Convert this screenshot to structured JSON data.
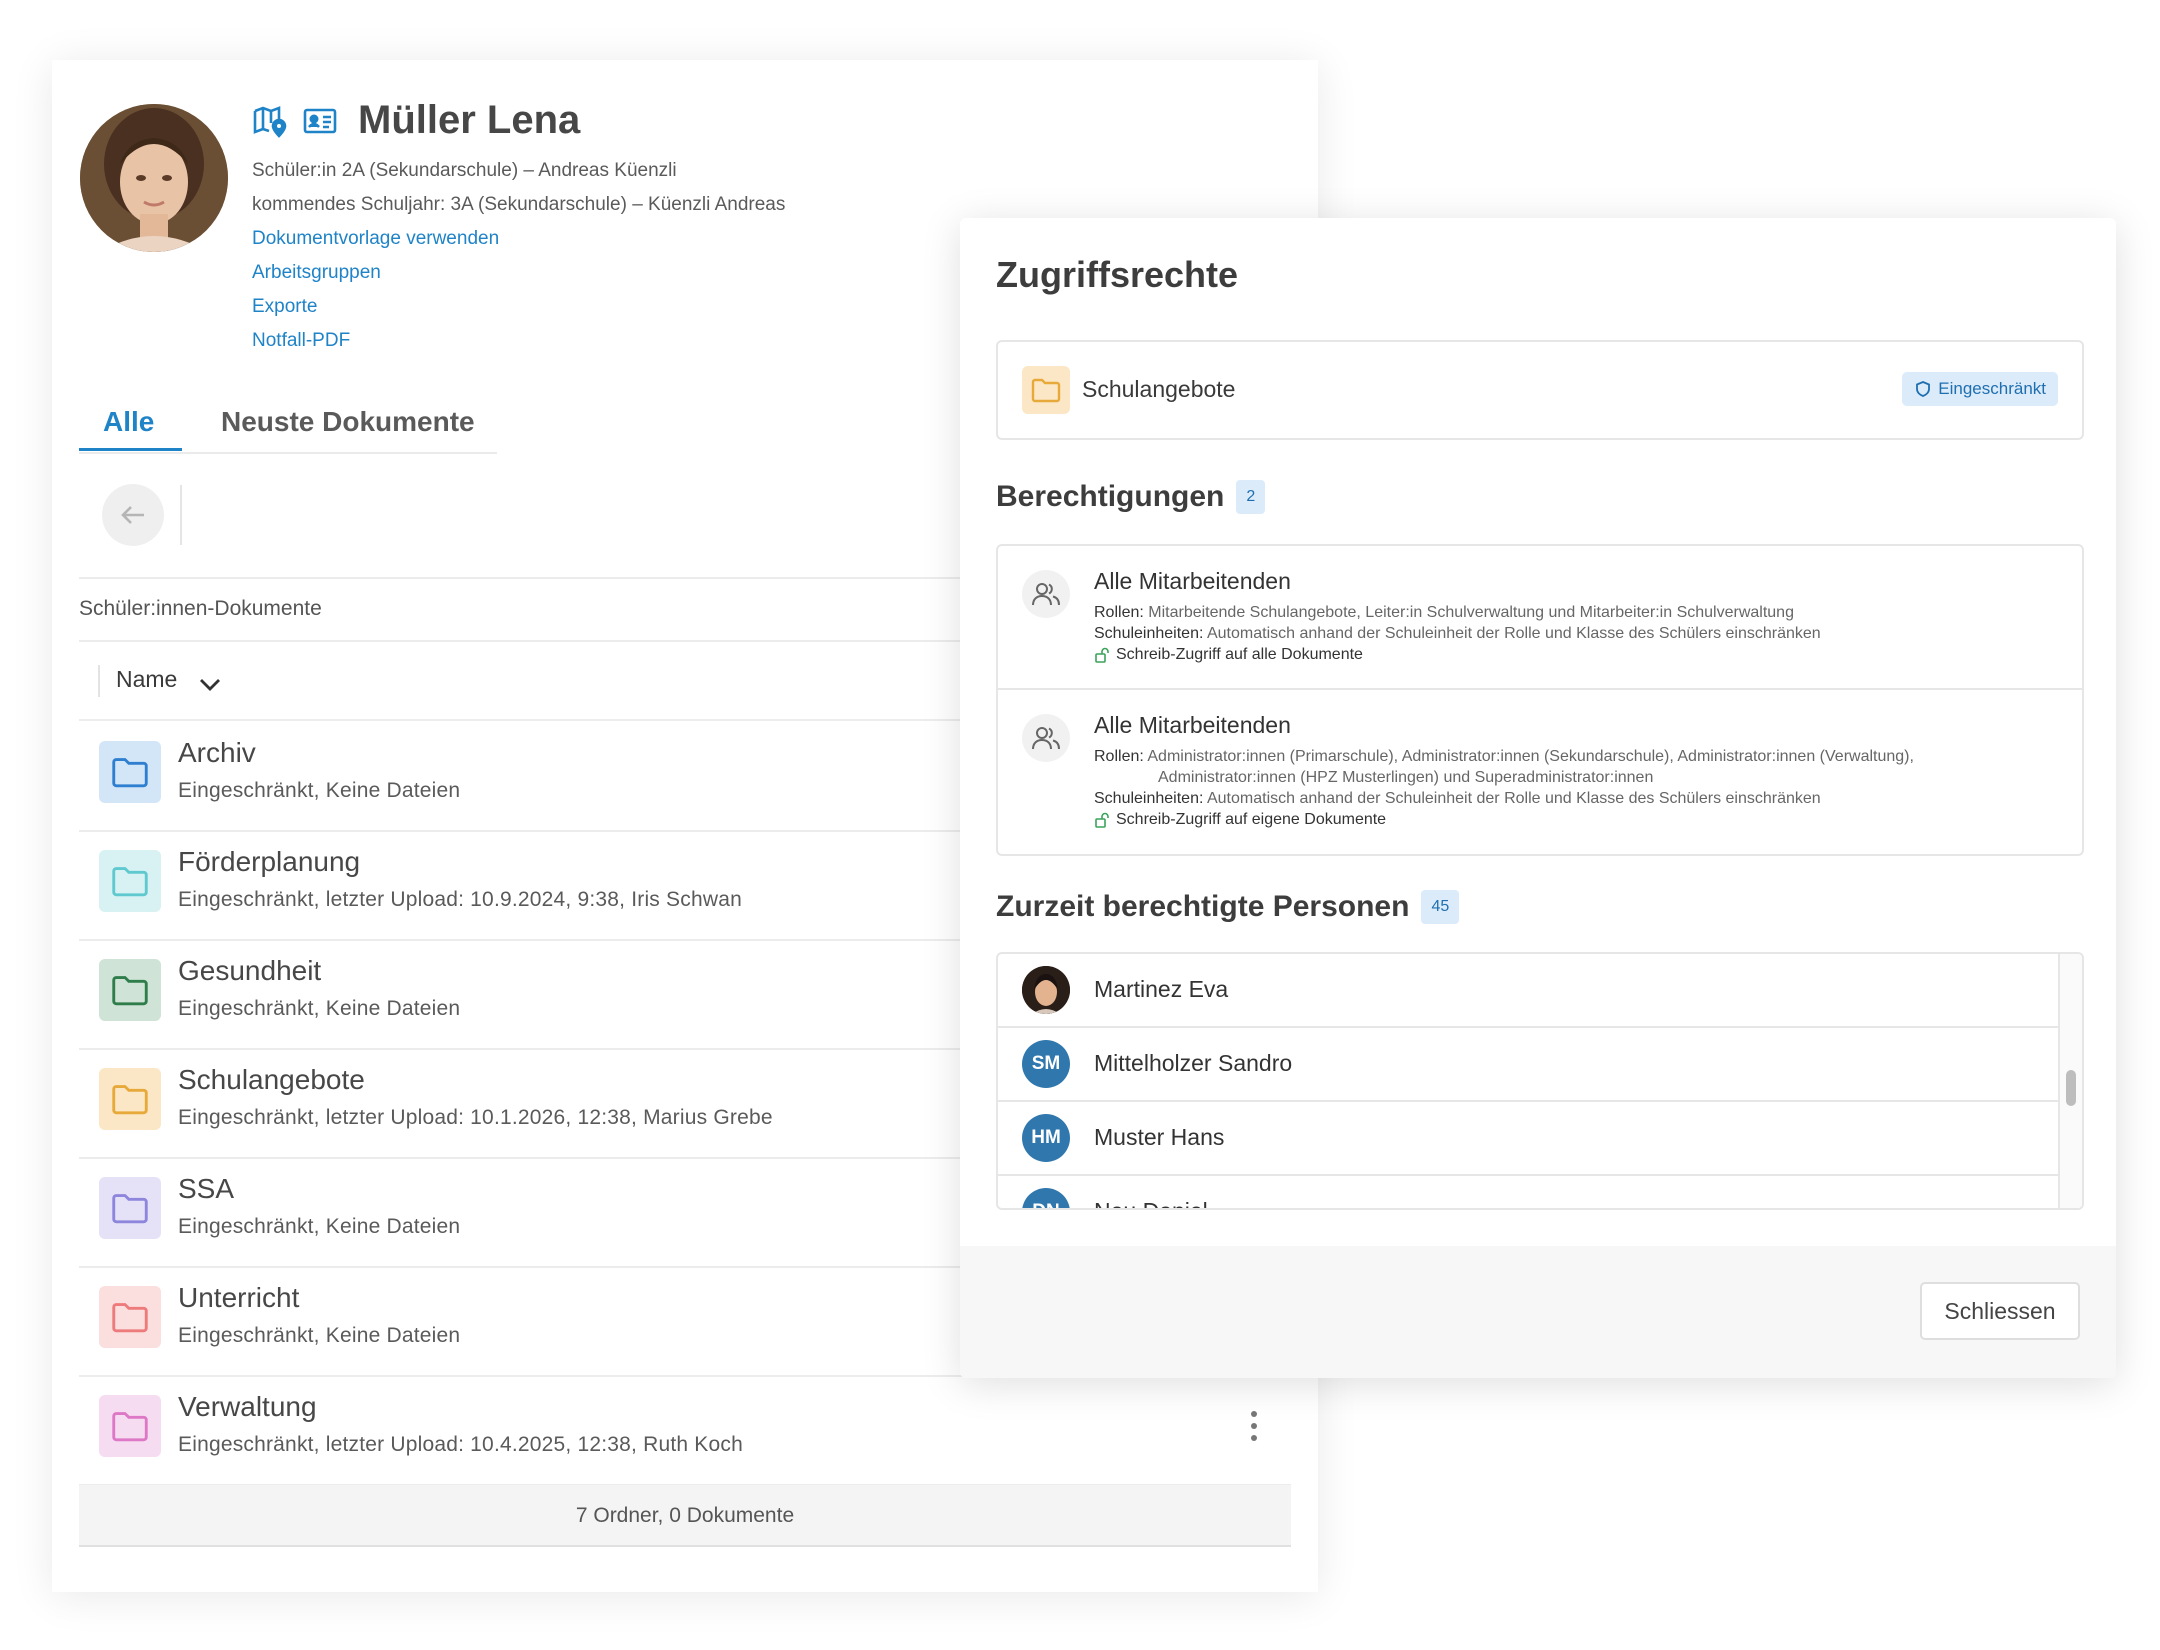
{
  "profile": {
    "name": "Müller Lena",
    "line1": "Schüler:in 2A (Sekundarschule) – Andreas Küenzli",
    "line2": "kommendes Schuljahr: 3A (Sekundarschule) – Küenzli Andreas",
    "links": [
      "Dokumentvorlage verwenden",
      "Arbeitsgruppen",
      "Exporte",
      "Notfall-PDF"
    ]
  },
  "tabs": {
    "all": "Alle",
    "recent": "Neuste Dokumente"
  },
  "breadcrumb": "Schüler:innen-Dokumente",
  "sort": {
    "label": "Name"
  },
  "folders": [
    {
      "name": "Archiv",
      "sub": "Eingeschränkt, Keine Dateien",
      "color": "#2f7fd0",
      "bg": "#d3e6f8"
    },
    {
      "name": "Förderplanung",
      "sub": "Eingeschränkt, letzter Upload: 10.9.2024, 9:38, Iris Schwan",
      "color": "#5fc9cf",
      "bg": "#d8f1f2"
    },
    {
      "name": "Gesundheit",
      "sub": "Eingeschränkt, Keine Dateien",
      "color": "#2f7d4a",
      "bg": "#cfe3d6"
    },
    {
      "name": "Schulangebote",
      "sub": "Eingeschränkt, letzter Upload: 10.1.2026, 12:38, Marius Grebe",
      "color": "#e8a93b",
      "bg": "#fbe7c6"
    },
    {
      "name": "SSA",
      "sub": "Eingeschränkt, Keine Dateien",
      "color": "#8d86dc",
      "bg": "#e5e2f8"
    },
    {
      "name": "Unterricht",
      "sub": "Eingeschränkt, Keine Dateien",
      "color": "#ee7b7b",
      "bg": "#fbdede"
    },
    {
      "name": "Verwaltung",
      "sub": "Eingeschränkt, letzter Upload: 10.4.2025, 12:38, Ruth Koch",
      "color": "#dd78c7",
      "bg": "#f6dcf1"
    }
  ],
  "footer": "7 Ordner, 0 Dokumente",
  "modal": {
    "title": "Zugriffsrechte",
    "folder": {
      "name": "Schulangebote",
      "badge": "Eingeschränkt"
    },
    "permissions_title": "Berechtigungen",
    "permissions_count": "2",
    "permissions": [
      {
        "title": "Alle Mitarbeitenden",
        "roles_label": "Rollen:",
        "roles": "Mitarbeitende Schulangebote, Leiter:in Schulverwaltung und Mitarbeiter:in Schulverwaltung",
        "roles_cont": "",
        "units_label": "Schuleinheiten:",
        "units": "Automatisch anhand der Schuleinheit der Rolle und Klasse des Schülers einschränken",
        "access": "Schreib-Zugriff auf alle Dokumente"
      },
      {
        "title": "Alle Mitarbeitenden",
        "roles_label": "Rollen:",
        "roles": "Administrator:innen (Primarschule), Administrator:innen (Sekundarschule), Administrator:innen (Verwaltung),",
        "roles_cont": "Administrator:innen (HPZ Musterlingen) und Superadministrator:innen",
        "units_label": "Schuleinheiten:",
        "units": "Automatisch anhand der Schuleinheit der Rolle und Klasse des Schülers einschränken",
        "access": "Schreib-Zugriff auf eigene Dokumente"
      }
    ],
    "people_title": "Zurzeit berechtigte Personen",
    "people_count": "45",
    "people": [
      {
        "initials": "",
        "name": "Martinez Eva"
      },
      {
        "initials": "SM",
        "name": "Mittelholzer Sandro"
      },
      {
        "initials": "HM",
        "name": "Muster Hans"
      },
      {
        "initials": "DN",
        "name": "Neu Daniel"
      }
    ],
    "close_label": "Schliessen"
  },
  "icons": [
    "map-pin-icon",
    "id-card-icon",
    "arrow-left-icon",
    "chevron-down-icon",
    "folder-icon",
    "kebab-icon",
    "shield-icon",
    "users-icon",
    "unlock-icon"
  ],
  "colors": {
    "accent": "#1f83c7",
    "badge_bg": "#dcebfa",
    "avatar_blue": "#2f77ad"
  }
}
